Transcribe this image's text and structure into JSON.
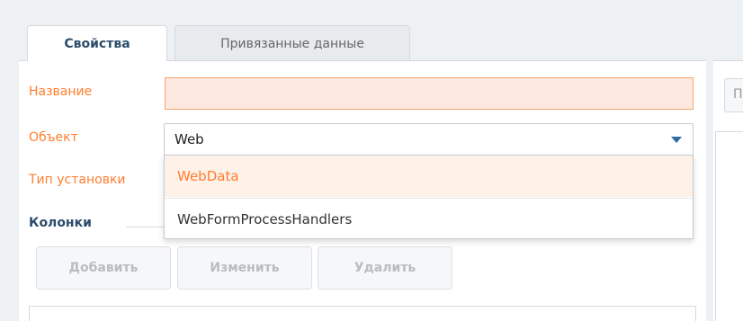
{
  "tabs": [
    {
      "label": "Свойства",
      "active": true
    },
    {
      "label": "Привязанные данные",
      "active": false
    }
  ],
  "form": {
    "name_label": "Название",
    "name_value": "",
    "object_label": "Объект",
    "object_value": "Web",
    "type_label": "Тип установки"
  },
  "dropdown": {
    "options": [
      "WebData",
      "WebFormProcessHandlers"
    ],
    "highlighted_index": 0
  },
  "columns": {
    "title": "Колонки",
    "add_label": "Добавить",
    "edit_label": "Изменить",
    "delete_label": "Удалить"
  },
  "right_panel": {
    "button_label": "П"
  },
  "colors": {
    "accent_orange": "#ff7e2f",
    "title_blue": "#2b4c6b",
    "arrow_blue": "#2e6ca4",
    "required_bg": "#fde9e0"
  }
}
